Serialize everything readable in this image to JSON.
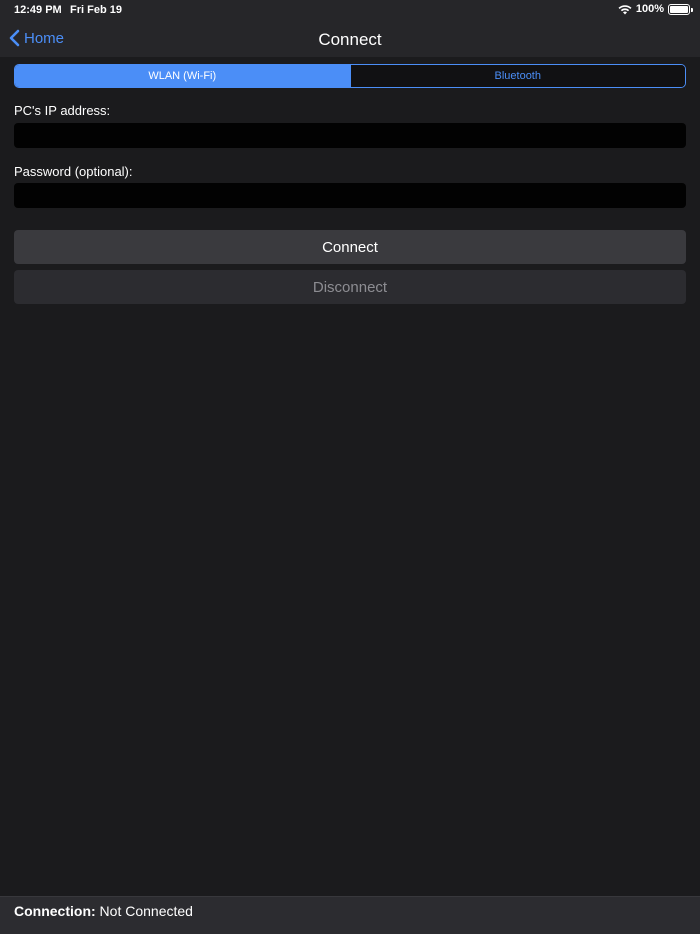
{
  "status_bar": {
    "time": "12:49 PM",
    "date": "Fri Feb 19",
    "battery": "100%"
  },
  "nav": {
    "back_label": "Home",
    "title": "Connect"
  },
  "segmented": {
    "options": [
      "WLAN (Wi-Fi)",
      "Bluetooth"
    ],
    "selected": "WLAN (Wi-Fi)"
  },
  "form": {
    "ip_label": "PC's IP address:",
    "ip_value": "",
    "password_label": "Password (optional):",
    "password_value": ""
  },
  "buttons": {
    "connect": "Connect",
    "disconnect": "Disconnect"
  },
  "footer": {
    "label": "Connection:",
    "value": "Not Connected"
  },
  "colors": {
    "accent": "#4b8ef7",
    "background": "#1b1b1d",
    "bar": "#262629",
    "field": "#020202"
  }
}
